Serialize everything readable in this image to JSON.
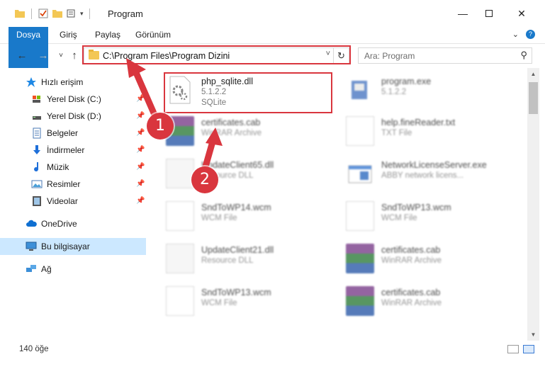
{
  "window": {
    "title": "Program"
  },
  "ribbon": {
    "tabs": [
      "Dosya",
      "Giriş",
      "Paylaş",
      "Görünüm"
    ]
  },
  "address": {
    "path": "C:\\Program Files\\Program Dizini"
  },
  "search": {
    "placeholder": "Ara: Program"
  },
  "sidebar": {
    "items": [
      {
        "label": "Hızlı erişim",
        "icon": "star-icon"
      },
      {
        "label": "Yerel Disk (C:)",
        "icon": "drive-icon"
      },
      {
        "label": "Yerel Disk (D:)",
        "icon": "drive-icon"
      },
      {
        "label": "Belgeler",
        "icon": "documents-icon"
      },
      {
        "label": "İndirmeler",
        "icon": "download-icon"
      },
      {
        "label": "Müzik",
        "icon": "music-icon"
      },
      {
        "label": "Resimler",
        "icon": "pictures-icon"
      },
      {
        "label": "Videolar",
        "icon": "video-icon"
      },
      {
        "label": "OneDrive",
        "icon": "cloud-icon"
      },
      {
        "label": "Bu bilgisayar",
        "icon": "computer-icon"
      },
      {
        "label": "Ağ",
        "icon": "network-icon"
      }
    ]
  },
  "files": [
    {
      "name": "php_sqlite.dll",
      "line1": "5.1.2.2",
      "line2": "SQLite",
      "icon": "dll-gear-icon"
    },
    {
      "name": "program.exe",
      "line1": "5.1.2.2",
      "line2": "",
      "icon": "exe-icon"
    },
    {
      "name": "certificates.cab",
      "line1": "WinRAR Archive",
      "line2": "",
      "icon": "winrar-icon"
    },
    {
      "name": "help.fineReader.txt",
      "line1": "TXT File",
      "line2": "",
      "icon": "text-file-icon"
    },
    {
      "name": "UpdateClient65.dll",
      "line1": "Resource DLL",
      "line2": "",
      "icon": "dll-icon"
    },
    {
      "name": "NetworkLicenseServer.exe",
      "line1": "ABBY network licens...",
      "line2": "",
      "icon": "exe-window-icon"
    },
    {
      "name": "SndToWP14.wcm",
      "line1": "WCM File",
      "line2": "",
      "icon": "blank-file-icon"
    },
    {
      "name": "SndToWP13.wcm",
      "line1": "WCM File",
      "line2": "",
      "icon": "blank-file-icon"
    },
    {
      "name": "UpdateClient21.dll",
      "line1": "Resource DLL",
      "line2": "",
      "icon": "dll-icon"
    },
    {
      "name": "certificates.cab",
      "line1": "WinRAR Archive",
      "line2": "",
      "icon": "winrar-icon"
    },
    {
      "name": "SndToWP13.wcm",
      "line1": "WCM File",
      "line2": "",
      "icon": "blank-file-icon"
    },
    {
      "name": "certificates.cab",
      "line1": "WinRAR Archive",
      "line2": "",
      "icon": "winrar-icon"
    }
  ],
  "status": {
    "count": "140 öğe"
  },
  "annotations": {
    "step1": "1",
    "step2": "2"
  },
  "colors": {
    "accent": "#1979ca",
    "annotation": "#d9363e",
    "selection": "#cce8ff"
  }
}
